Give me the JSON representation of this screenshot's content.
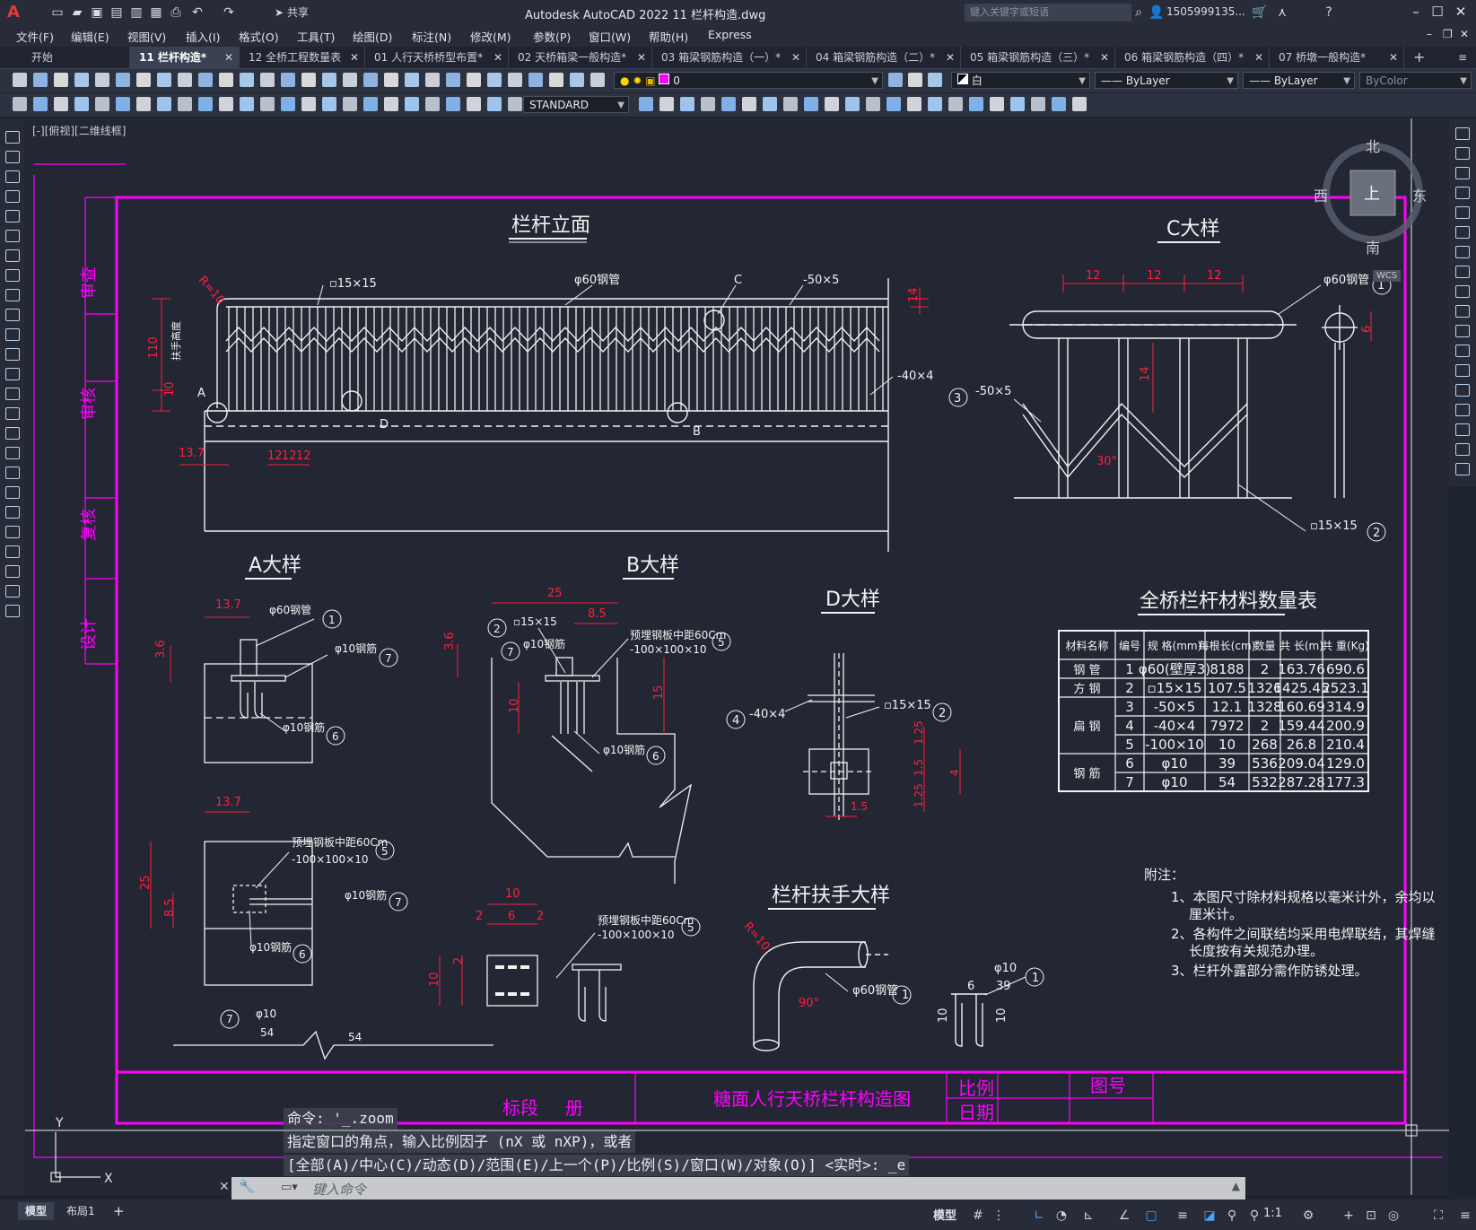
{
  "app": {
    "logo": "A",
    "title": "Autodesk AutoCAD 2022    11 栏杆构造.dwg",
    "share": "共享",
    "search_placeholder": "键入关键字或短语",
    "user": "1505999135...",
    "help": "?"
  },
  "menu": [
    "文件(F)",
    "编辑(E)",
    "视图(V)",
    "插入(I)",
    "格式(O)",
    "工具(T)",
    "绘图(D)",
    "标注(N)",
    "修改(M)",
    "参数(P)",
    "窗口(W)",
    "帮助(H)",
    "Express"
  ],
  "tabs": [
    {
      "label": "开始",
      "closable": false,
      "active": false
    },
    {
      "label": "11 栏杆构造*",
      "closable": true,
      "active": true
    },
    {
      "label": "12 全桥工程数量表",
      "closable": true,
      "active": false
    },
    {
      "label": "01 人行天桥桥型布置*",
      "closable": true,
      "active": false
    },
    {
      "label": "02 天桥箱梁一般构造*",
      "closable": true,
      "active": false
    },
    {
      "label": "03 箱梁钢筋构造（一）*",
      "closable": true,
      "active": false
    },
    {
      "label": "04 箱梁钢筋构造（二）*",
      "closable": true,
      "active": false
    },
    {
      "label": "05 箱梁钢筋构造（三）*",
      "closable": true,
      "active": false
    },
    {
      "label": "06 箱梁钢筋构造（四）*",
      "closable": true,
      "active": false
    },
    {
      "label": "07 桥墩一般构造*",
      "closable": true,
      "active": false
    }
  ],
  "toolbar": {
    "layer": "0",
    "color": "白",
    "linetype": "ByLayer",
    "lineweight": "ByLayer",
    "plotstyle": "ByColor",
    "textstyle": "STANDARD"
  },
  "viewport": {
    "label": "[-][俯视][二维线框]",
    "compass": {
      "n": "北",
      "s": "南",
      "e": "东",
      "w": "西",
      "top": "上",
      "wcs": "WCS"
    }
  },
  "drawing": {
    "main_title": "栏杆立面",
    "c_title": "C大样",
    "a_title": "A大样",
    "b_title": "B大样",
    "d_title": "D大样",
    "handrail_title": "栏杆扶手大样",
    "table_title": "全桥栏杆材料数量表",
    "side_labels": [
      "审查",
      "审核",
      "复核",
      "设计"
    ],
    "titleblock": {
      "section": "标段",
      "book": "册",
      "name": "糖面人行天桥栏杆构造图",
      "scale": "比例",
      "date": "日期",
      "drawing_no": "图号"
    },
    "notes_title": "附注：",
    "notes": [
      "1、本图尺寸除材料规格以毫米计外，余均以",
      "厘米计。",
      "2、各构件之间联结均采用电焊联结，其焊缝",
      "长度按有关规范办理。",
      "3、栏杆外露部分需作防锈处理。"
    ],
    "table_headers": [
      "材料名称",
      "编号",
      "规 格(mm)",
      "每根长(cm)",
      "数量",
      "共 长(m)",
      "共 重(Kg)"
    ],
    "table_rows": [
      [
        "钢 管",
        "1",
        "φ60(壁厚3)",
        "8188",
        "2",
        "163.76",
        "690.6"
      ],
      [
        "方 钢",
        "2",
        "▫15×15",
        "107.5",
        "1326",
        "1425.45",
        "2523.1"
      ],
      [
        "",
        "3",
        "-50×5",
        "12.1",
        "1328",
        "160.69",
        "314.9"
      ],
      [
        "扁 钢",
        "4",
        "-40×4",
        "7972",
        "2",
        "159.44",
        "200.9"
      ],
      [
        "",
        "5",
        "-100×10",
        "10",
        "268",
        "26.8",
        "210.4"
      ],
      [
        "钢 筋",
        "6",
        "φ10",
        "39",
        "536",
        "209.04",
        "129.0"
      ],
      [
        "",
        "7",
        "φ10",
        "54",
        "532",
        "287.28",
        "177.3"
      ]
    ],
    "main_labels": {
      "r10": "R=10",
      "sq15": "▫15×15",
      "pipe60": "φ60钢管",
      "c": "C",
      "flat50": "-50×5",
      "flat40": "-40×4",
      "a": "A",
      "b": "B",
      "d": "D",
      "h110": "110",
      "h10": "10",
      "h14": "14",
      "d137": "13.7",
      "d12": "12",
      "vert_text": "扶手高度"
    },
    "c_labels": {
      "d12": "12",
      "pipe60": "φ60钢管",
      "flat50": "-50×5",
      "sq15": "▫15×15",
      "h14": "14",
      "h6": "6",
      "angle": "30°",
      "n1": "1",
      "n2": "2",
      "n3": "3"
    },
    "a_labels": {
      "d137": "13.7",
      "pipe60": "φ60钢管",
      "r10a": "φ10钢筋",
      "r10b": "φ10钢筋",
      "h36": "3.6",
      "n1": "1",
      "n6": "6",
      "n7": "7",
      "d137b": "13.7",
      "plate": "预埋钢板中距60Cm",
      "plate2": "-100×100×10",
      "r10c": "φ10钢筋",
      "r10d": "φ10钢筋",
      "h25": "25",
      "h85": "8.5",
      "n5": "5",
      "n7b": "7",
      "n6b": "6",
      "bar_len1": "54",
      "bar_len2": "54",
      "bar_n": "7",
      "bar_phi": "φ10"
    },
    "b_labels": {
      "d25": "25",
      "d85": "8.5",
      "sq15": "▫15×15",
      "r10": "φ10钢筋",
      "plate": "预埋钢板中距60Cm",
      "plate2": "-100×100×10",
      "h36": "3.6",
      "h10": "10",
      "h15": "15",
      "r10b": "φ10钢筋",
      "n2": "2",
      "n7": "7",
      "n5": "5",
      "n6": "6",
      "d10": "10",
      "d2": "2",
      "d6": "6",
      "h2": "2",
      "plate3": "预埋钢板中距60Cm",
      "plate4": "-100×100×10",
      "n5b": "5"
    },
    "d_labels": {
      "flat40": "-40×4",
      "sq15": "▫15×15",
      "n4": "4",
      "n2": "2",
      "h125": "1.25",
      "h15": "1.5",
      "h4": "4",
      "h125b": "1.25",
      "d15": "1.5"
    },
    "hr_labels": {
      "r10": "R=10",
      "pipe60": "φ60钢管",
      "angle": "90°",
      "n1": "1",
      "phi10": "φ10",
      "n1b": "1",
      "d6": "6",
      "d39": "39",
      "h10": "10",
      "h10b": "10"
    }
  },
  "command": {
    "history": [
      "命令: '_.zoom",
      "指定窗口的角点，输入比例因子 (nX 或 nXP)，或者",
      "[全部(A)/中心(C)/动态(D)/范围(E)/上一个(P)/比例(S)/窗口(W)/对象(O)] <实时>: _e"
    ],
    "placeholder": "键入命令"
  },
  "status": {
    "layouts": [
      "模型",
      "布局1"
    ],
    "mode": "模型",
    "scale": "1:1"
  },
  "colors": {
    "magenta": "#ff00ff",
    "red": "#ff1f3d",
    "white": "#f2f2f2",
    "bg": "#222733"
  }
}
